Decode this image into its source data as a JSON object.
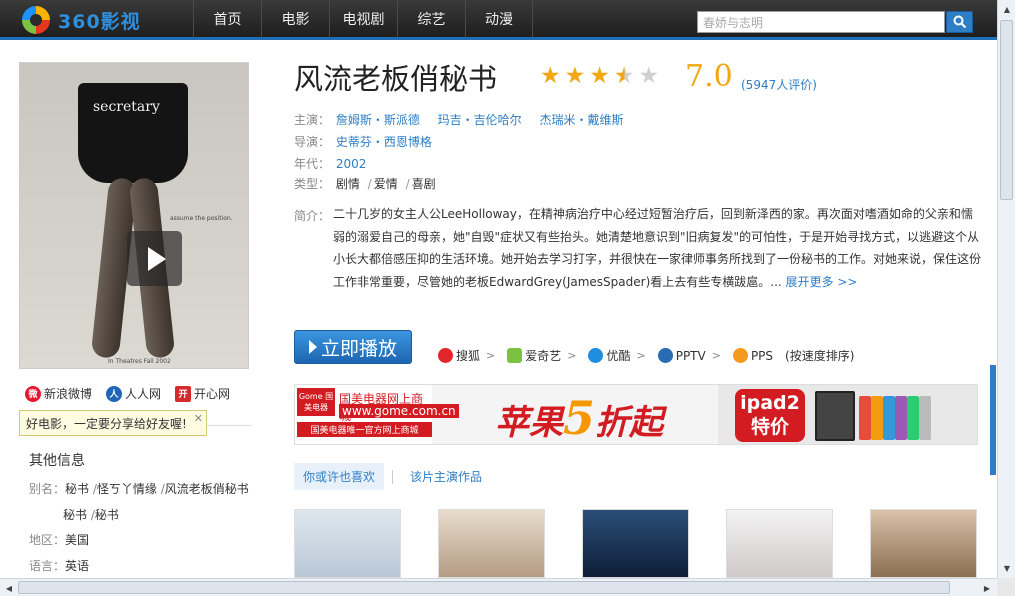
{
  "header": {
    "logo_text": "360影视",
    "nav": [
      "首页",
      "电影",
      "电视剧",
      "综艺",
      "动漫"
    ],
    "search_placeholder": "春娇与志明"
  },
  "poster": {
    "title_text": "secretary",
    "tagline": "assume the position.",
    "release_note": "In Theatres Fall 2002"
  },
  "share": {
    "items": [
      "新浪微博",
      "人人网",
      "开心网"
    ],
    "tip": "好电影，一定要分享给好友喔!"
  },
  "other_info": {
    "title": "其他信息",
    "alias_label": "别名：",
    "alias_line1": [
      "秘书",
      "怪ㄎ丫情缘",
      "风流老板俏秘书"
    ],
    "alias_line2": [
      "秘书",
      "秘书"
    ],
    "region_label": "地区：",
    "region": "美国",
    "language_label": "语言：",
    "language": "英语"
  },
  "movie": {
    "title": "风流老板俏秘书",
    "rating": 3.5,
    "score": "7.0",
    "rating_count": "(5947人评价)",
    "cast_label": "主演：",
    "cast": [
      "詹姆斯・斯派德",
      "玛吉・吉伦哈尔",
      "杰瑞米・戴维斯"
    ],
    "director_label": "导演：",
    "director": "史蒂芬・西恩博格",
    "year_label": "年代：",
    "year": "2002",
    "genre_label": "类型：",
    "genres": [
      "剧情",
      "爱情",
      "喜剧"
    ],
    "synopsis_label": "简介：",
    "synopsis": "二十几岁的女主人公LeeHolloway，在精神病治疗中心经过短暂治疗后，回到新泽西的家。再次面对嗜酒如命的父亲和懦弱的溺爱自己的母亲，她\"自毁\"症状又有些抬头。她清楚地意识到\"旧病复发\"的可怕性，于是开始寻找方式，以逃避这个从小长大都倍感压抑的生活环境。她开始去学习打字，并很快在一家律师事务所找到了一份秘书的工作。对她来说，保住这份工作非常重要，尽管她的老板EdwardGrey(JamesSpader)看上去有些专横跋扈。...",
    "expand_label": "展开更多 >>"
  },
  "play": {
    "button_label": "立即播放",
    "sources": [
      "搜狐",
      "爱奇艺",
      "优酷",
      "PPTV",
      "PPS"
    ],
    "sort_note": "(按速度排序)"
  },
  "banner": {
    "brand_top": "Gome 国美电器",
    "brand_name": "国美电器网上商城",
    "brand_url": "www.gome.com.cn",
    "brand_sub": "国美电器唯一官方网上商城",
    "promo_pre": "苹果",
    "promo_num": "5",
    "promo_post": "折起",
    "badge_line1": "ipad2",
    "badge_line2": "特价"
  },
  "tabs": [
    "你或许也喜欢",
    "该片主演作品"
  ]
}
